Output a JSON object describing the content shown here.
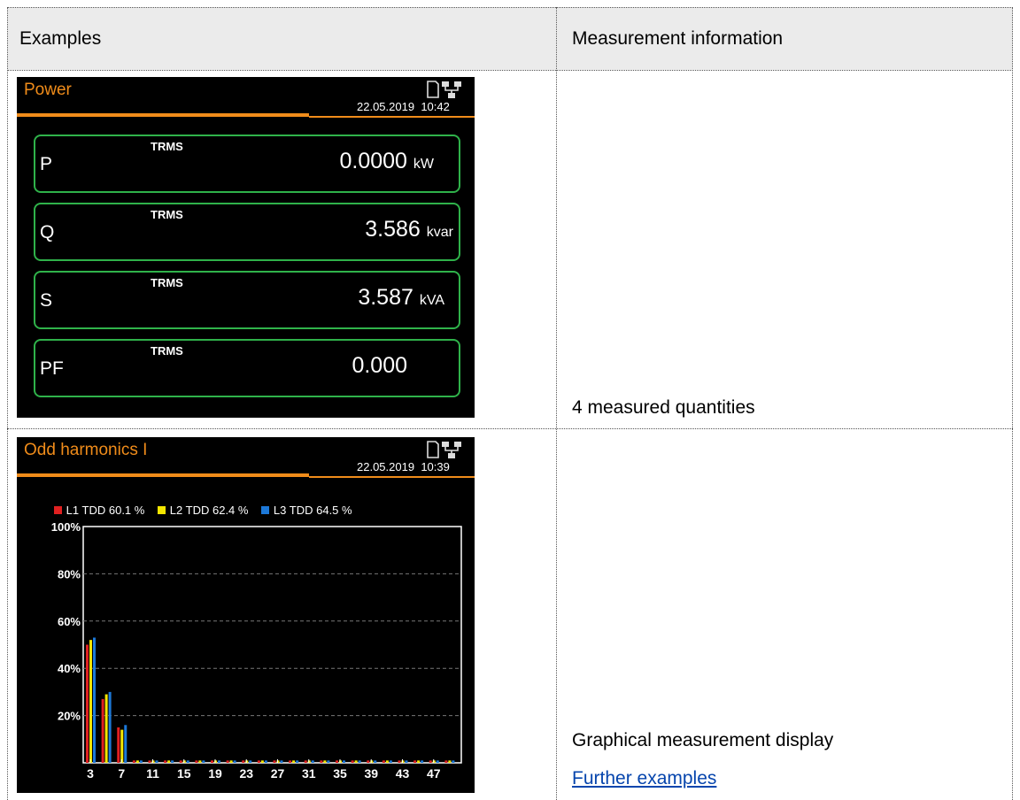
{
  "table": {
    "col1_header": "Examples",
    "col2_header": "Measurement information"
  },
  "rows": [
    {
      "info_text": "4 measured quantities",
      "screen": {
        "title": "Power",
        "date": "22.05.2019",
        "time": "10:42",
        "boxes": [
          {
            "label": "P",
            "mode": "TRMS",
            "value": "0.0000",
            "unit": "kW"
          },
          {
            "label": "Q",
            "mode": "TRMS",
            "value": "3.586",
            "unit": "kvar"
          },
          {
            "label": "S",
            "mode": "TRMS",
            "value": "3.587",
            "unit": "kVA"
          },
          {
            "label": "PF",
            "mode": "TRMS",
            "value": "0.000",
            "unit": ""
          }
        ]
      }
    },
    {
      "info_text": "Graphical measurement display",
      "link_text": "Further examples",
      "screen": {
        "title": "Odd harmonics I",
        "date": "22.05.2019",
        "time": "10:39",
        "legend": [
          {
            "name": "L1",
            "text": "TDD 60.1 %",
            "color": "#e02020"
          },
          {
            "name": "L2",
            "text": "TDD 62.4 %",
            "color": "#f4e600"
          },
          {
            "name": "L3",
            "text": "TDD 64.5 %",
            "color": "#1c78d8"
          }
        ]
      }
    }
  ],
  "chart_data": {
    "type": "bar",
    "title": "Odd harmonics I",
    "categories": [
      "3",
      "5",
      "7",
      "9",
      "11",
      "13",
      "15",
      "17",
      "19",
      "21",
      "23",
      "25",
      "27",
      "29",
      "31",
      "33",
      "35",
      "37",
      "39",
      "41",
      "43",
      "45",
      "47",
      "49"
    ],
    "x_tick_labels": [
      "3",
      "7",
      "11",
      "15",
      "19",
      "23",
      "27",
      "31",
      "35",
      "39",
      "43",
      "47"
    ],
    "y_tick_labels": [
      "100%",
      "80%",
      "60%",
      "40%",
      "20%"
    ],
    "ylim": [
      0,
      100
    ],
    "grid": true,
    "legend_placement": "top",
    "series": [
      {
        "name": "L1",
        "color": "#e02020",
        "values": [
          50,
          27,
          15,
          1,
          1,
          1,
          1,
          1,
          1,
          1,
          1,
          1,
          1,
          1,
          1,
          1,
          1,
          1,
          1,
          1,
          1,
          1,
          1,
          1
        ]
      },
      {
        "name": "L2",
        "color": "#f4e600",
        "values": [
          52,
          29,
          14,
          1,
          1,
          1,
          1,
          1,
          1,
          1,
          1,
          1,
          1,
          1,
          1,
          1,
          1,
          1,
          1,
          1,
          1,
          1,
          1,
          1
        ]
      },
      {
        "name": "L3",
        "color": "#1c78d8",
        "values": [
          53,
          30,
          16,
          1,
          1,
          1,
          1,
          1,
          1,
          1,
          1,
          1,
          1,
          1,
          1,
          1,
          1,
          1,
          1,
          1,
          1,
          1,
          1,
          1
        ]
      }
    ]
  }
}
